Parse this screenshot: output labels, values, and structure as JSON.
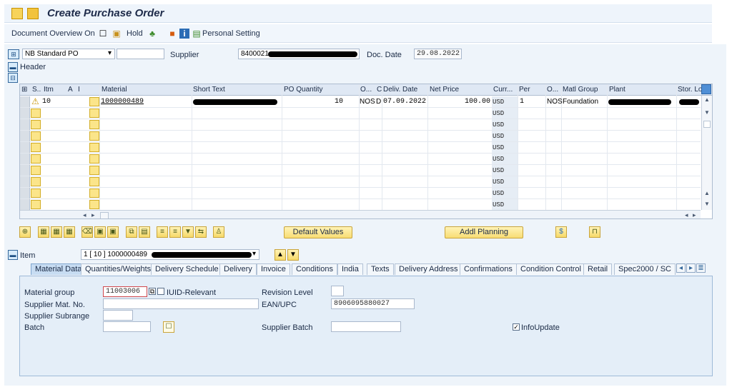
{
  "window": {
    "title": "Create Purchase Order"
  },
  "toolbar": {
    "document_overview": "Document Overview On",
    "hold": "Hold",
    "personal_setting": "Personal Setting"
  },
  "header": {
    "po_type": "NB Standard PO",
    "po_type_extra": "",
    "supplier_label": "Supplier",
    "supplier_value": "8400021",
    "doc_date_label": "Doc. Date",
    "doc_date_value": "29.08.2022",
    "section_label": "Header"
  },
  "table": {
    "columns": [
      "S..",
      "Itm",
      "A",
      "I",
      "Material",
      "Short Text",
      "PO Quantity",
      "O...",
      "C",
      "Deliv. Date",
      "Net Price",
      "Curr...",
      "Per",
      "O...",
      "Matl Group",
      "Plant",
      "Stor. Lo"
    ],
    "rows": [
      {
        "itm": "10",
        "material": "1000000489",
        "qty": "10",
        "ouom": "NOS",
        "c": "D",
        "deliv_date": "07.09.2022",
        "net_price": "100.00",
        "curr": "USD",
        "per": "1",
        "oun": "NOS",
        "matl_group": "Foundation"
      }
    ],
    "empty_curr": "USD"
  },
  "buttons": {
    "default_values": "Default Values",
    "addl_planning": "Addl Planning"
  },
  "item": {
    "label": "Item",
    "selector": "1 [ 10 ] 1000000489"
  },
  "tabs": [
    "Material Data",
    "Quantities/Weights",
    "Delivery Schedule",
    "Delivery",
    "Invoice",
    "Conditions",
    "India",
    "Texts",
    "Delivery Address",
    "Confirmations",
    "Condition Control",
    "Retail",
    "Spec2000 / SC"
  ],
  "material_data": {
    "material_group_label": "Material group",
    "material_group_value": "11003006",
    "iuid_label": "IUID-Relevant",
    "revision_level_label": "Revision Level",
    "supplier_mat_label": "Supplier Mat. No.",
    "ean_label": "EAN/UPC",
    "ean_value": "8906095880027",
    "supplier_subrange_label": "Supplier Subrange",
    "batch_label": "Batch",
    "supplier_batch_label": "Supplier Batch",
    "infoupdate_label": "InfoUpdate",
    "infoupdate_checked": true
  }
}
